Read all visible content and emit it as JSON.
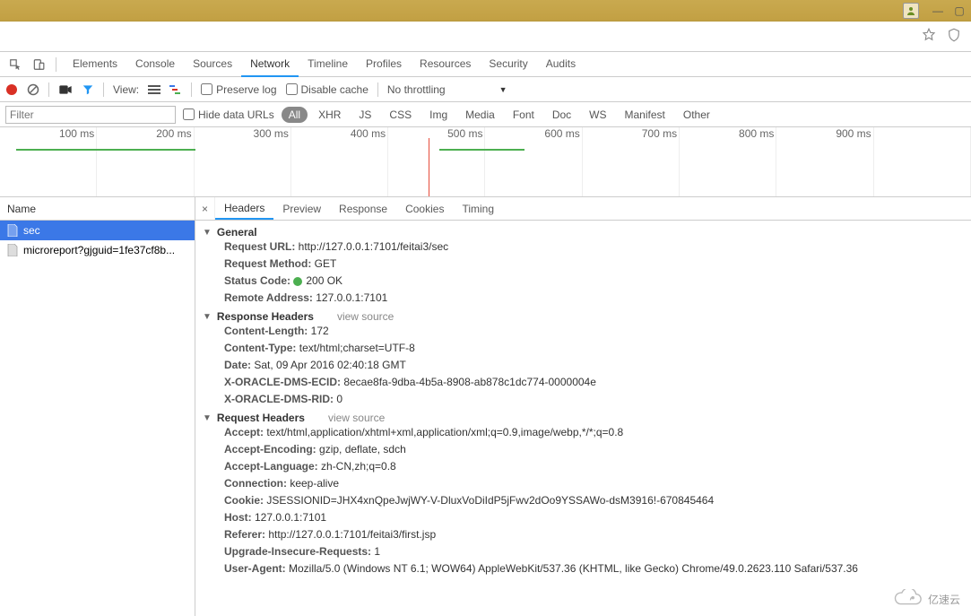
{
  "window": {
    "user_icon": "user",
    "minimize": "—",
    "maximize": "▢"
  },
  "devtools_tabs": [
    "Elements",
    "Console",
    "Sources",
    "Network",
    "Timeline",
    "Profiles",
    "Resources",
    "Security",
    "Audits"
  ],
  "devtools_active_tab": "Network",
  "toolbar": {
    "view_label": "View:",
    "preserve_log": "Preserve log",
    "disable_cache": "Disable cache",
    "throttling": "No throttling"
  },
  "filter_row": {
    "filter_placeholder": "Filter",
    "hide_data_urls": "Hide data URLs",
    "types": [
      "All",
      "XHR",
      "JS",
      "CSS",
      "Img",
      "Media",
      "Font",
      "Doc",
      "WS",
      "Manifest",
      "Other"
    ],
    "active_type": "All"
  },
  "timeline_ticks": [
    "100 ms",
    "200 ms",
    "300 ms",
    "400 ms",
    "500 ms",
    "600 ms",
    "700 ms",
    "800 ms",
    "900 ms"
  ],
  "name_column": {
    "header": "Name",
    "items": [
      {
        "label": "sec",
        "selected": true
      },
      {
        "label": "microreport?gjguid=1fe37cf8b...",
        "selected": false
      }
    ]
  },
  "details_tabs": [
    "Headers",
    "Preview",
    "Response",
    "Cookies",
    "Timing"
  ],
  "details_active_tab": "Headers",
  "details_close": "×",
  "headers": {
    "general": {
      "title": "General",
      "items": [
        {
          "k": "Request URL:",
          "v": "http://127.0.0.1:7101/feitai3/sec"
        },
        {
          "k": "Request Method:",
          "v": "GET"
        },
        {
          "k": "Status Code:",
          "v": "200 OK",
          "status": true
        },
        {
          "k": "Remote Address:",
          "v": "127.0.0.1:7101"
        }
      ]
    },
    "response": {
      "title": "Response Headers",
      "view_source": "view source",
      "items": [
        {
          "k": "Content-Length:",
          "v": "172"
        },
        {
          "k": "Content-Type:",
          "v": "text/html;charset=UTF-8"
        },
        {
          "k": "Date:",
          "v": "Sat, 09 Apr 2016 02:40:18 GMT"
        },
        {
          "k": "X-ORACLE-DMS-ECID:",
          "v": "8ecae8fa-9dba-4b5a-8908-ab878c1dc774-0000004e"
        },
        {
          "k": "X-ORACLE-DMS-RID:",
          "v": "0"
        }
      ]
    },
    "request": {
      "title": "Request Headers",
      "view_source": "view source",
      "items": [
        {
          "k": "Accept:",
          "v": "text/html,application/xhtml+xml,application/xml;q=0.9,image/webp,*/*;q=0.8"
        },
        {
          "k": "Accept-Encoding:",
          "v": "gzip, deflate, sdch"
        },
        {
          "k": "Accept-Language:",
          "v": "zh-CN,zh;q=0.8"
        },
        {
          "k": "Connection:",
          "v": "keep-alive"
        },
        {
          "k": "Cookie:",
          "v": "JSESSIONID=JHX4xnQpeJwjWY-V-DluxVoDiIdP5jFwv2dOo9YSSAWo-dsM3916!-670845464"
        },
        {
          "k": "Host:",
          "v": "127.0.0.1:7101"
        },
        {
          "k": "Referer:",
          "v": "http://127.0.0.1:7101/feitai3/first.jsp"
        },
        {
          "k": "Upgrade-Insecure-Requests:",
          "v": "1"
        },
        {
          "k": "User-Agent:",
          "v": "Mozilla/5.0 (Windows NT 6.1; WOW64) AppleWebKit/537.36 (KHTML, like Gecko) Chrome/49.0.2623.110 Safari/537.36"
        }
      ]
    }
  },
  "watermark": "亿速云"
}
